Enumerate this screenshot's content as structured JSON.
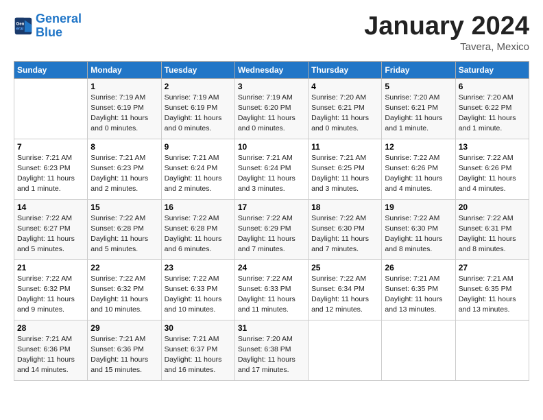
{
  "header": {
    "logo_line1": "General",
    "logo_line2": "Blue",
    "month_title": "January 2024",
    "subtitle": "Tavera, Mexico"
  },
  "weekdays": [
    "Sunday",
    "Monday",
    "Tuesday",
    "Wednesday",
    "Thursday",
    "Friday",
    "Saturday"
  ],
  "weeks": [
    [
      {
        "day": "",
        "info": ""
      },
      {
        "day": "1",
        "info": "Sunrise: 7:19 AM\nSunset: 6:19 PM\nDaylight: 11 hours\nand 0 minutes."
      },
      {
        "day": "2",
        "info": "Sunrise: 7:19 AM\nSunset: 6:19 PM\nDaylight: 11 hours\nand 0 minutes."
      },
      {
        "day": "3",
        "info": "Sunrise: 7:19 AM\nSunset: 6:20 PM\nDaylight: 11 hours\nand 0 minutes."
      },
      {
        "day": "4",
        "info": "Sunrise: 7:20 AM\nSunset: 6:21 PM\nDaylight: 11 hours\nand 0 minutes."
      },
      {
        "day": "5",
        "info": "Sunrise: 7:20 AM\nSunset: 6:21 PM\nDaylight: 11 hours\nand 1 minute."
      },
      {
        "day": "6",
        "info": "Sunrise: 7:20 AM\nSunset: 6:22 PM\nDaylight: 11 hours\nand 1 minute."
      }
    ],
    [
      {
        "day": "7",
        "info": "Sunrise: 7:21 AM\nSunset: 6:23 PM\nDaylight: 11 hours\nand 1 minute."
      },
      {
        "day": "8",
        "info": "Sunrise: 7:21 AM\nSunset: 6:23 PM\nDaylight: 11 hours\nand 2 minutes."
      },
      {
        "day": "9",
        "info": "Sunrise: 7:21 AM\nSunset: 6:24 PM\nDaylight: 11 hours\nand 2 minutes."
      },
      {
        "day": "10",
        "info": "Sunrise: 7:21 AM\nSunset: 6:24 PM\nDaylight: 11 hours\nand 3 minutes."
      },
      {
        "day": "11",
        "info": "Sunrise: 7:21 AM\nSunset: 6:25 PM\nDaylight: 11 hours\nand 3 minutes."
      },
      {
        "day": "12",
        "info": "Sunrise: 7:22 AM\nSunset: 6:26 PM\nDaylight: 11 hours\nand 4 minutes."
      },
      {
        "day": "13",
        "info": "Sunrise: 7:22 AM\nSunset: 6:26 PM\nDaylight: 11 hours\nand 4 minutes."
      }
    ],
    [
      {
        "day": "14",
        "info": "Sunrise: 7:22 AM\nSunset: 6:27 PM\nDaylight: 11 hours\nand 5 minutes."
      },
      {
        "day": "15",
        "info": "Sunrise: 7:22 AM\nSunset: 6:28 PM\nDaylight: 11 hours\nand 5 minutes."
      },
      {
        "day": "16",
        "info": "Sunrise: 7:22 AM\nSunset: 6:28 PM\nDaylight: 11 hours\nand 6 minutes."
      },
      {
        "day": "17",
        "info": "Sunrise: 7:22 AM\nSunset: 6:29 PM\nDaylight: 11 hours\nand 7 minutes."
      },
      {
        "day": "18",
        "info": "Sunrise: 7:22 AM\nSunset: 6:30 PM\nDaylight: 11 hours\nand 7 minutes."
      },
      {
        "day": "19",
        "info": "Sunrise: 7:22 AM\nSunset: 6:30 PM\nDaylight: 11 hours\nand 8 minutes."
      },
      {
        "day": "20",
        "info": "Sunrise: 7:22 AM\nSunset: 6:31 PM\nDaylight: 11 hours\nand 8 minutes."
      }
    ],
    [
      {
        "day": "21",
        "info": "Sunrise: 7:22 AM\nSunset: 6:32 PM\nDaylight: 11 hours\nand 9 minutes."
      },
      {
        "day": "22",
        "info": "Sunrise: 7:22 AM\nSunset: 6:32 PM\nDaylight: 11 hours\nand 10 minutes."
      },
      {
        "day": "23",
        "info": "Sunrise: 7:22 AM\nSunset: 6:33 PM\nDaylight: 11 hours\nand 10 minutes."
      },
      {
        "day": "24",
        "info": "Sunrise: 7:22 AM\nSunset: 6:33 PM\nDaylight: 11 hours\nand 11 minutes."
      },
      {
        "day": "25",
        "info": "Sunrise: 7:22 AM\nSunset: 6:34 PM\nDaylight: 11 hours\nand 12 minutes."
      },
      {
        "day": "26",
        "info": "Sunrise: 7:21 AM\nSunset: 6:35 PM\nDaylight: 11 hours\nand 13 minutes."
      },
      {
        "day": "27",
        "info": "Sunrise: 7:21 AM\nSunset: 6:35 PM\nDaylight: 11 hours\nand 13 minutes."
      }
    ],
    [
      {
        "day": "28",
        "info": "Sunrise: 7:21 AM\nSunset: 6:36 PM\nDaylight: 11 hours\nand 14 minutes."
      },
      {
        "day": "29",
        "info": "Sunrise: 7:21 AM\nSunset: 6:36 PM\nDaylight: 11 hours\nand 15 minutes."
      },
      {
        "day": "30",
        "info": "Sunrise: 7:21 AM\nSunset: 6:37 PM\nDaylight: 11 hours\nand 16 minutes."
      },
      {
        "day": "31",
        "info": "Sunrise: 7:20 AM\nSunset: 6:38 PM\nDaylight: 11 hours\nand 17 minutes."
      },
      {
        "day": "",
        "info": ""
      },
      {
        "day": "",
        "info": ""
      },
      {
        "day": "",
        "info": ""
      }
    ]
  ]
}
